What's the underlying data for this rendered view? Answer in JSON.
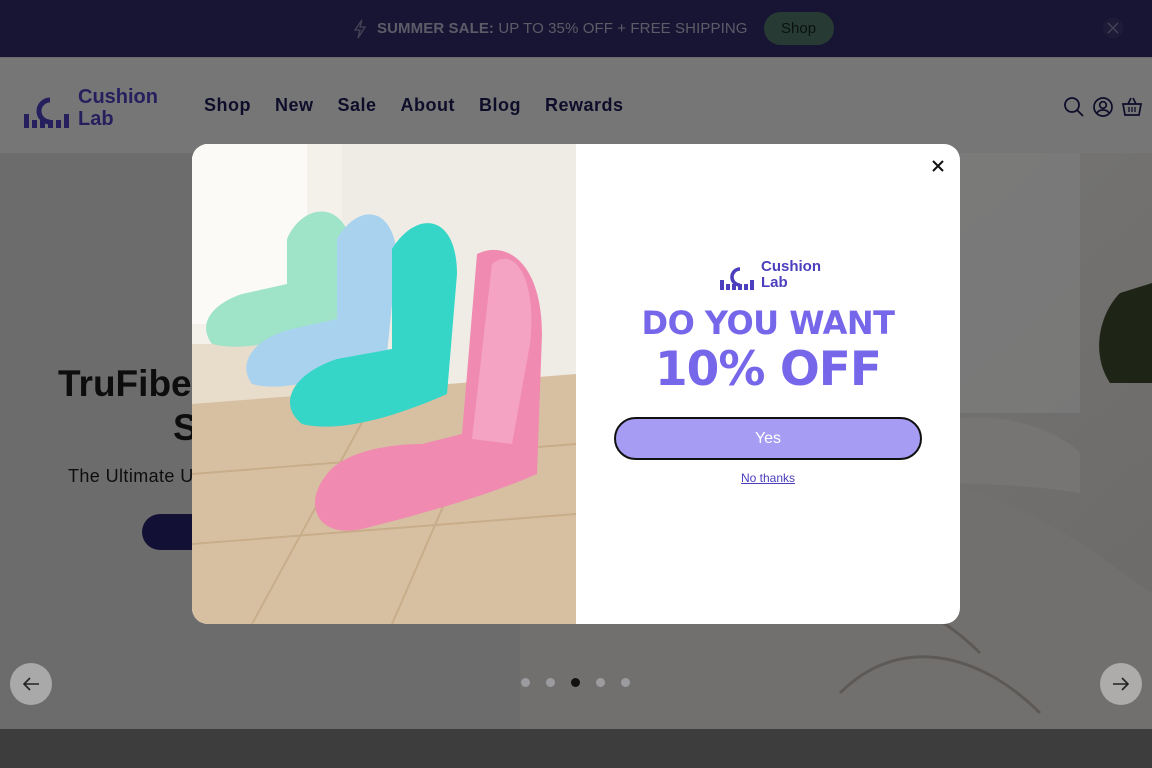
{
  "announcement": {
    "bold": "SUMMER SALE:",
    "text": " UP TO 35% OFF + FREE SHIPPING",
    "button": "Shop"
  },
  "brand": {
    "line1": "Cushion",
    "line2": "Lab"
  },
  "nav": [
    "Shop",
    "New",
    "Sale",
    "About",
    "Blog",
    "Rewards"
  ],
  "hero": {
    "title_visible": "TruFibe",
    "title_line2_visible": "S",
    "subtitle_visible": "The Ultimate U",
    "slides": 5,
    "active_slide": 3
  },
  "modal": {
    "headline1": "DO YOU WANT",
    "headline2": "10% OFF",
    "yes": "Yes",
    "no": "No thanks"
  },
  "colors": {
    "announce_bg": "#2f2a66",
    "brand": "#4b3fbd",
    "modal_accent": "#7667ea",
    "yes_bg": "#a79cf3"
  }
}
